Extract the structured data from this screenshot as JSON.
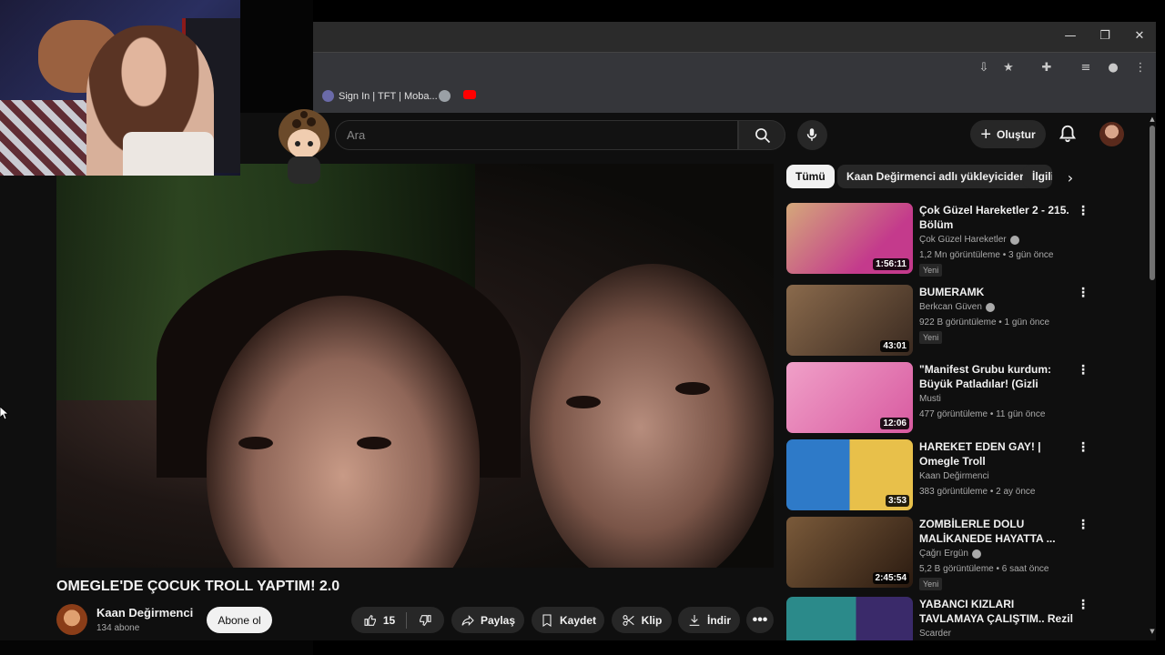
{
  "browser": {
    "bookmarks": [
      {
        "label": "Sign In | TFT | Moba...",
        "icon": "tft-icon"
      },
      {
        "label": "",
        "icon": "globe-icon"
      },
      {
        "label": "",
        "icon": "youtube-icon"
      }
    ]
  },
  "header": {
    "search_placeholder": "Ara",
    "create_label": "Oluştur"
  },
  "video": {
    "title": "OMEGLE'DE ÇOCUK TROLL YAPTIM! 2.0",
    "channel": "Kaan Değirmenci",
    "subscribers": "134 abone",
    "subscribe_label": "Abone ol",
    "likes": "15",
    "share_label": "Paylaş",
    "save_label": "Kaydet",
    "clip_label": "Klip",
    "download_label": "İndir"
  },
  "chips": [
    "Tümü",
    "Kaan Değirmenci adlı yükleyiciden",
    "İlgili"
  ],
  "recommendations": [
    {
      "title": "Çok Güzel Hareketler 2 - 215. Bölüm",
      "channel": "Çok Güzel Hareketler",
      "verified": true,
      "meta": "1,2 Mn görüntüleme • 3 gün önce",
      "badge": "Yeni",
      "duration": "1:56:11",
      "thumb_color": "#c43a8c"
    },
    {
      "title": "BUMERAMK",
      "channel": "Berkcan Güven",
      "verified": true,
      "meta": "922 B görüntüleme • 1 gün önce",
      "badge": "Yeni",
      "duration": "43:01",
      "thumb_color": "#6b4a34"
    },
    {
      "title": "\"Manifest Grubu kurdum: Büyük Patladılar! (Gizli Operasyon)",
      "channel": "Musti",
      "verified": false,
      "meta": "477 görüntüleme • 11 gün önce",
      "badge": "",
      "duration": "12:06",
      "thumb_color": "#e07ab8"
    },
    {
      "title": "HAREKET EDEN GAY! | Omegle Troll",
      "channel": "Kaan Değirmenci",
      "verified": false,
      "meta": "383 görüntüleme • 2 ay önce",
      "badge": "",
      "duration": "3:53",
      "thumb_color": "#2e7ac8"
    },
    {
      "title": "ZOMBİLERLE DOLU MALİKANEDE HAYATTA ...",
      "channel": "Çağrı Ergün",
      "verified": true,
      "meta": "5,2 B görüntüleme • 6 saat önce",
      "badge": "Yeni",
      "duration": "2:45:54",
      "thumb_color": "#5a3a22"
    },
    {
      "title": "YABANCI KIZLARI TAVLAMAYA ÇALIŞTIM.. Rezil Olduk (Komi...",
      "channel": "Scarder",
      "verified": false,
      "meta": "",
      "badge": "",
      "duration": "",
      "thumb_color": "#2b8a8a"
    }
  ]
}
